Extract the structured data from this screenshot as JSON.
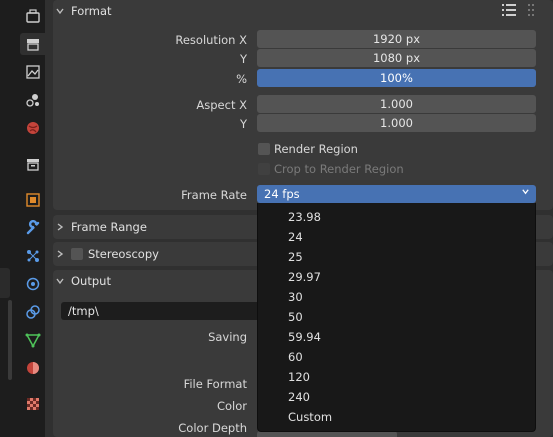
{
  "tabs": [
    {
      "icon": "tool-icon",
      "active": false
    },
    {
      "icon": "render-icon",
      "active": false
    },
    {
      "icon": "output-icon",
      "active": true
    },
    {
      "icon": "view-layer-icon",
      "active": false
    },
    {
      "icon": "scene-icon",
      "active": false
    },
    {
      "icon": "world-icon",
      "active": false
    },
    {
      "icon": "collection-icon",
      "active": false
    },
    {
      "icon": "object-icon",
      "active": false
    },
    {
      "icon": "modifier-icon",
      "active": false
    },
    {
      "icon": "particles-icon",
      "active": false
    },
    {
      "icon": "physics-icon",
      "active": false
    },
    {
      "icon": "constraints-icon",
      "active": false
    },
    {
      "icon": "data-icon",
      "active": false
    },
    {
      "icon": "material-icon",
      "active": false
    },
    {
      "icon": "texture-icon",
      "active": false
    }
  ],
  "format": {
    "header": "Format",
    "resolution_x_label": "Resolution X",
    "resolution_x": "1920 px",
    "resolution_y_label": "Y",
    "resolution_y": "1080 px",
    "percent_label": "%",
    "percent": "100%",
    "percent_fill": 1.0,
    "aspect_x_label": "Aspect X",
    "aspect_x": "1.000",
    "aspect_y_label": "Y",
    "aspect_y": "1.000",
    "render_region": "Render Region",
    "crop_region": "Crop to Render Region",
    "frame_rate_label": "Frame Rate",
    "frame_rate": "24 fps"
  },
  "frame_range": {
    "header": "Frame Range"
  },
  "stereoscopy": {
    "header": "Stereoscopy"
  },
  "output": {
    "header": "Output",
    "path": "/tmp\\",
    "saving_label": "Saving",
    "file_format_label": "File Format",
    "color_label": "Color",
    "color_depth_label": "Color Depth"
  },
  "frame_rate_options": [
    "23.98",
    "24",
    "25",
    "29.97",
    "30",
    "50",
    "59.94",
    "60",
    "120",
    "240",
    "Custom"
  ],
  "colors": {
    "accent": "#4772b3",
    "panel": "#303030",
    "field": "#545454",
    "dropdown": "#181818"
  }
}
